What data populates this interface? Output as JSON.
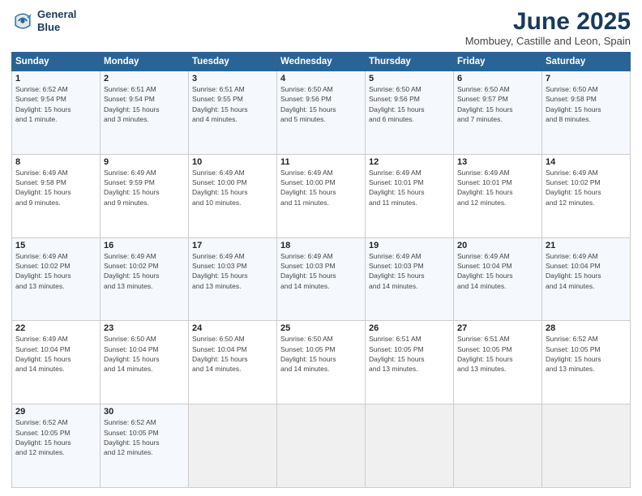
{
  "logo": {
    "line1": "General",
    "line2": "Blue"
  },
  "title": "June 2025",
  "subtitle": "Mombuey, Castille and Leon, Spain",
  "weekdays": [
    "Sunday",
    "Monday",
    "Tuesday",
    "Wednesday",
    "Thursday",
    "Friday",
    "Saturday"
  ],
  "weeks": [
    [
      {
        "day": "1",
        "info": "Sunrise: 6:52 AM\nSunset: 9:54 PM\nDaylight: 15 hours\nand 1 minute."
      },
      {
        "day": "2",
        "info": "Sunrise: 6:51 AM\nSunset: 9:54 PM\nDaylight: 15 hours\nand 3 minutes."
      },
      {
        "day": "3",
        "info": "Sunrise: 6:51 AM\nSunset: 9:55 PM\nDaylight: 15 hours\nand 4 minutes."
      },
      {
        "day": "4",
        "info": "Sunrise: 6:50 AM\nSunset: 9:56 PM\nDaylight: 15 hours\nand 5 minutes."
      },
      {
        "day": "5",
        "info": "Sunrise: 6:50 AM\nSunset: 9:56 PM\nDaylight: 15 hours\nand 6 minutes."
      },
      {
        "day": "6",
        "info": "Sunrise: 6:50 AM\nSunset: 9:57 PM\nDaylight: 15 hours\nand 7 minutes."
      },
      {
        "day": "7",
        "info": "Sunrise: 6:50 AM\nSunset: 9:58 PM\nDaylight: 15 hours\nand 8 minutes."
      }
    ],
    [
      {
        "day": "8",
        "info": "Sunrise: 6:49 AM\nSunset: 9:58 PM\nDaylight: 15 hours\nand 9 minutes."
      },
      {
        "day": "9",
        "info": "Sunrise: 6:49 AM\nSunset: 9:59 PM\nDaylight: 15 hours\nand 9 minutes."
      },
      {
        "day": "10",
        "info": "Sunrise: 6:49 AM\nSunset: 10:00 PM\nDaylight: 15 hours\nand 10 minutes."
      },
      {
        "day": "11",
        "info": "Sunrise: 6:49 AM\nSunset: 10:00 PM\nDaylight: 15 hours\nand 11 minutes."
      },
      {
        "day": "12",
        "info": "Sunrise: 6:49 AM\nSunset: 10:01 PM\nDaylight: 15 hours\nand 11 minutes."
      },
      {
        "day": "13",
        "info": "Sunrise: 6:49 AM\nSunset: 10:01 PM\nDaylight: 15 hours\nand 12 minutes."
      },
      {
        "day": "14",
        "info": "Sunrise: 6:49 AM\nSunset: 10:02 PM\nDaylight: 15 hours\nand 12 minutes."
      }
    ],
    [
      {
        "day": "15",
        "info": "Sunrise: 6:49 AM\nSunset: 10:02 PM\nDaylight: 15 hours\nand 13 minutes."
      },
      {
        "day": "16",
        "info": "Sunrise: 6:49 AM\nSunset: 10:02 PM\nDaylight: 15 hours\nand 13 minutes."
      },
      {
        "day": "17",
        "info": "Sunrise: 6:49 AM\nSunset: 10:03 PM\nDaylight: 15 hours\nand 13 minutes."
      },
      {
        "day": "18",
        "info": "Sunrise: 6:49 AM\nSunset: 10:03 PM\nDaylight: 15 hours\nand 14 minutes."
      },
      {
        "day": "19",
        "info": "Sunrise: 6:49 AM\nSunset: 10:03 PM\nDaylight: 15 hours\nand 14 minutes."
      },
      {
        "day": "20",
        "info": "Sunrise: 6:49 AM\nSunset: 10:04 PM\nDaylight: 15 hours\nand 14 minutes."
      },
      {
        "day": "21",
        "info": "Sunrise: 6:49 AM\nSunset: 10:04 PM\nDaylight: 15 hours\nand 14 minutes."
      }
    ],
    [
      {
        "day": "22",
        "info": "Sunrise: 6:49 AM\nSunset: 10:04 PM\nDaylight: 15 hours\nand 14 minutes."
      },
      {
        "day": "23",
        "info": "Sunrise: 6:50 AM\nSunset: 10:04 PM\nDaylight: 15 hours\nand 14 minutes."
      },
      {
        "day": "24",
        "info": "Sunrise: 6:50 AM\nSunset: 10:04 PM\nDaylight: 15 hours\nand 14 minutes."
      },
      {
        "day": "25",
        "info": "Sunrise: 6:50 AM\nSunset: 10:05 PM\nDaylight: 15 hours\nand 14 minutes."
      },
      {
        "day": "26",
        "info": "Sunrise: 6:51 AM\nSunset: 10:05 PM\nDaylight: 15 hours\nand 13 minutes."
      },
      {
        "day": "27",
        "info": "Sunrise: 6:51 AM\nSunset: 10:05 PM\nDaylight: 15 hours\nand 13 minutes."
      },
      {
        "day": "28",
        "info": "Sunrise: 6:52 AM\nSunset: 10:05 PM\nDaylight: 15 hours\nand 13 minutes."
      }
    ],
    [
      {
        "day": "29",
        "info": "Sunrise: 6:52 AM\nSunset: 10:05 PM\nDaylight: 15 hours\nand 12 minutes."
      },
      {
        "day": "30",
        "info": "Sunrise: 6:52 AM\nSunset: 10:05 PM\nDaylight: 15 hours\nand 12 minutes."
      },
      {
        "day": "",
        "info": ""
      },
      {
        "day": "",
        "info": ""
      },
      {
        "day": "",
        "info": ""
      },
      {
        "day": "",
        "info": ""
      },
      {
        "day": "",
        "info": ""
      }
    ]
  ]
}
